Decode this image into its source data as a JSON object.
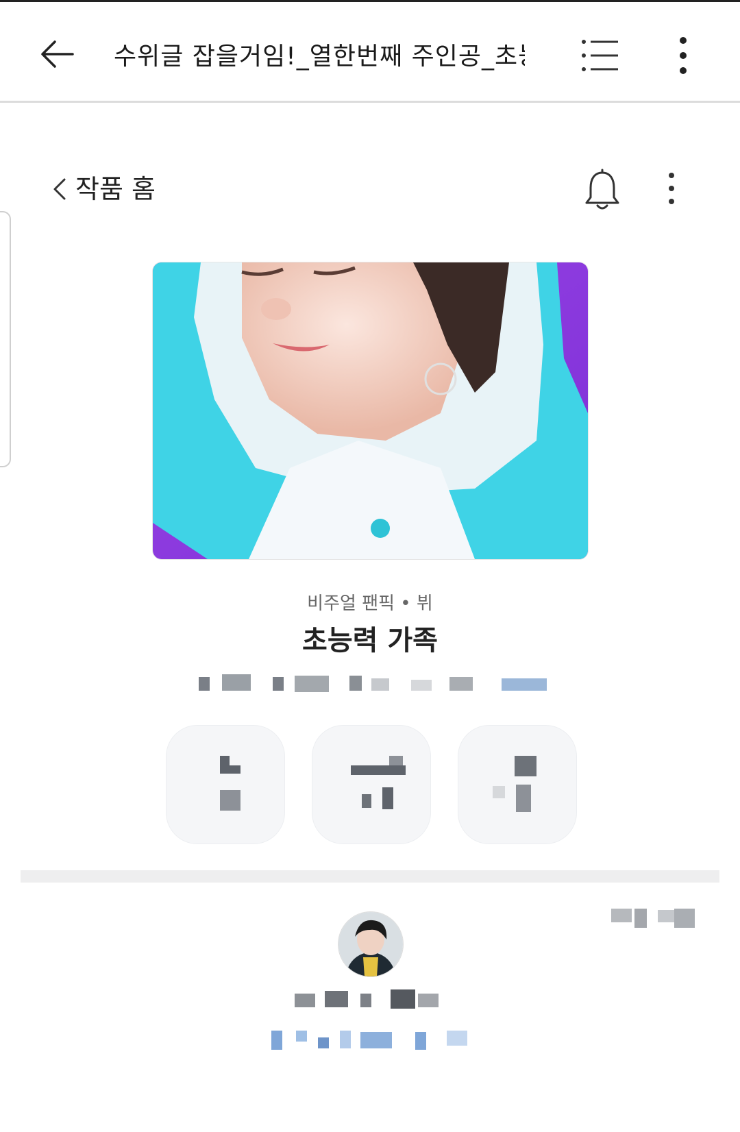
{
  "topbar": {
    "title": "수위글 잡을거임!_열한번째 주인공_초능…"
  },
  "sub_header": {
    "home_label": "작품 홈"
  },
  "work": {
    "genre": "비주얼 팬픽 • 뷔",
    "title": "초능력 가족"
  },
  "icons": {
    "back": "arrow-left-icon",
    "list": "list-icon",
    "more": "more-vertical-icon",
    "bell": "bell-icon",
    "chevron": "chevron-left-icon"
  },
  "colors": {
    "accent_blue": "#7fa6d8",
    "cover_purple": "#9b46e6",
    "cover_cyan": "#3fd3e6"
  }
}
